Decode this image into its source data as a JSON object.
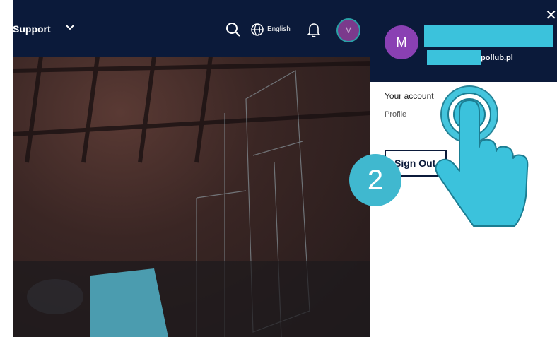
{
  "topbar": {
    "nav_label": "Support",
    "nav_chevron": "⌄",
    "language": "English",
    "avatar_initial": "M",
    "icons": [
      "search-icon",
      "globe-icon",
      "bell-icon"
    ]
  },
  "panel": {
    "close": "✕",
    "avatar_initial": "M",
    "email_suffix": "pollub.pl",
    "your_account": "Your account",
    "profile": "Profile",
    "sign_out": "Sign Out"
  },
  "annotation": {
    "step_number": "2",
    "icon": "tap-hand-icon"
  },
  "colors": {
    "header_bg": "#0b1a3a",
    "accent": "#3bc2dc",
    "avatar": "#8a40b3"
  }
}
